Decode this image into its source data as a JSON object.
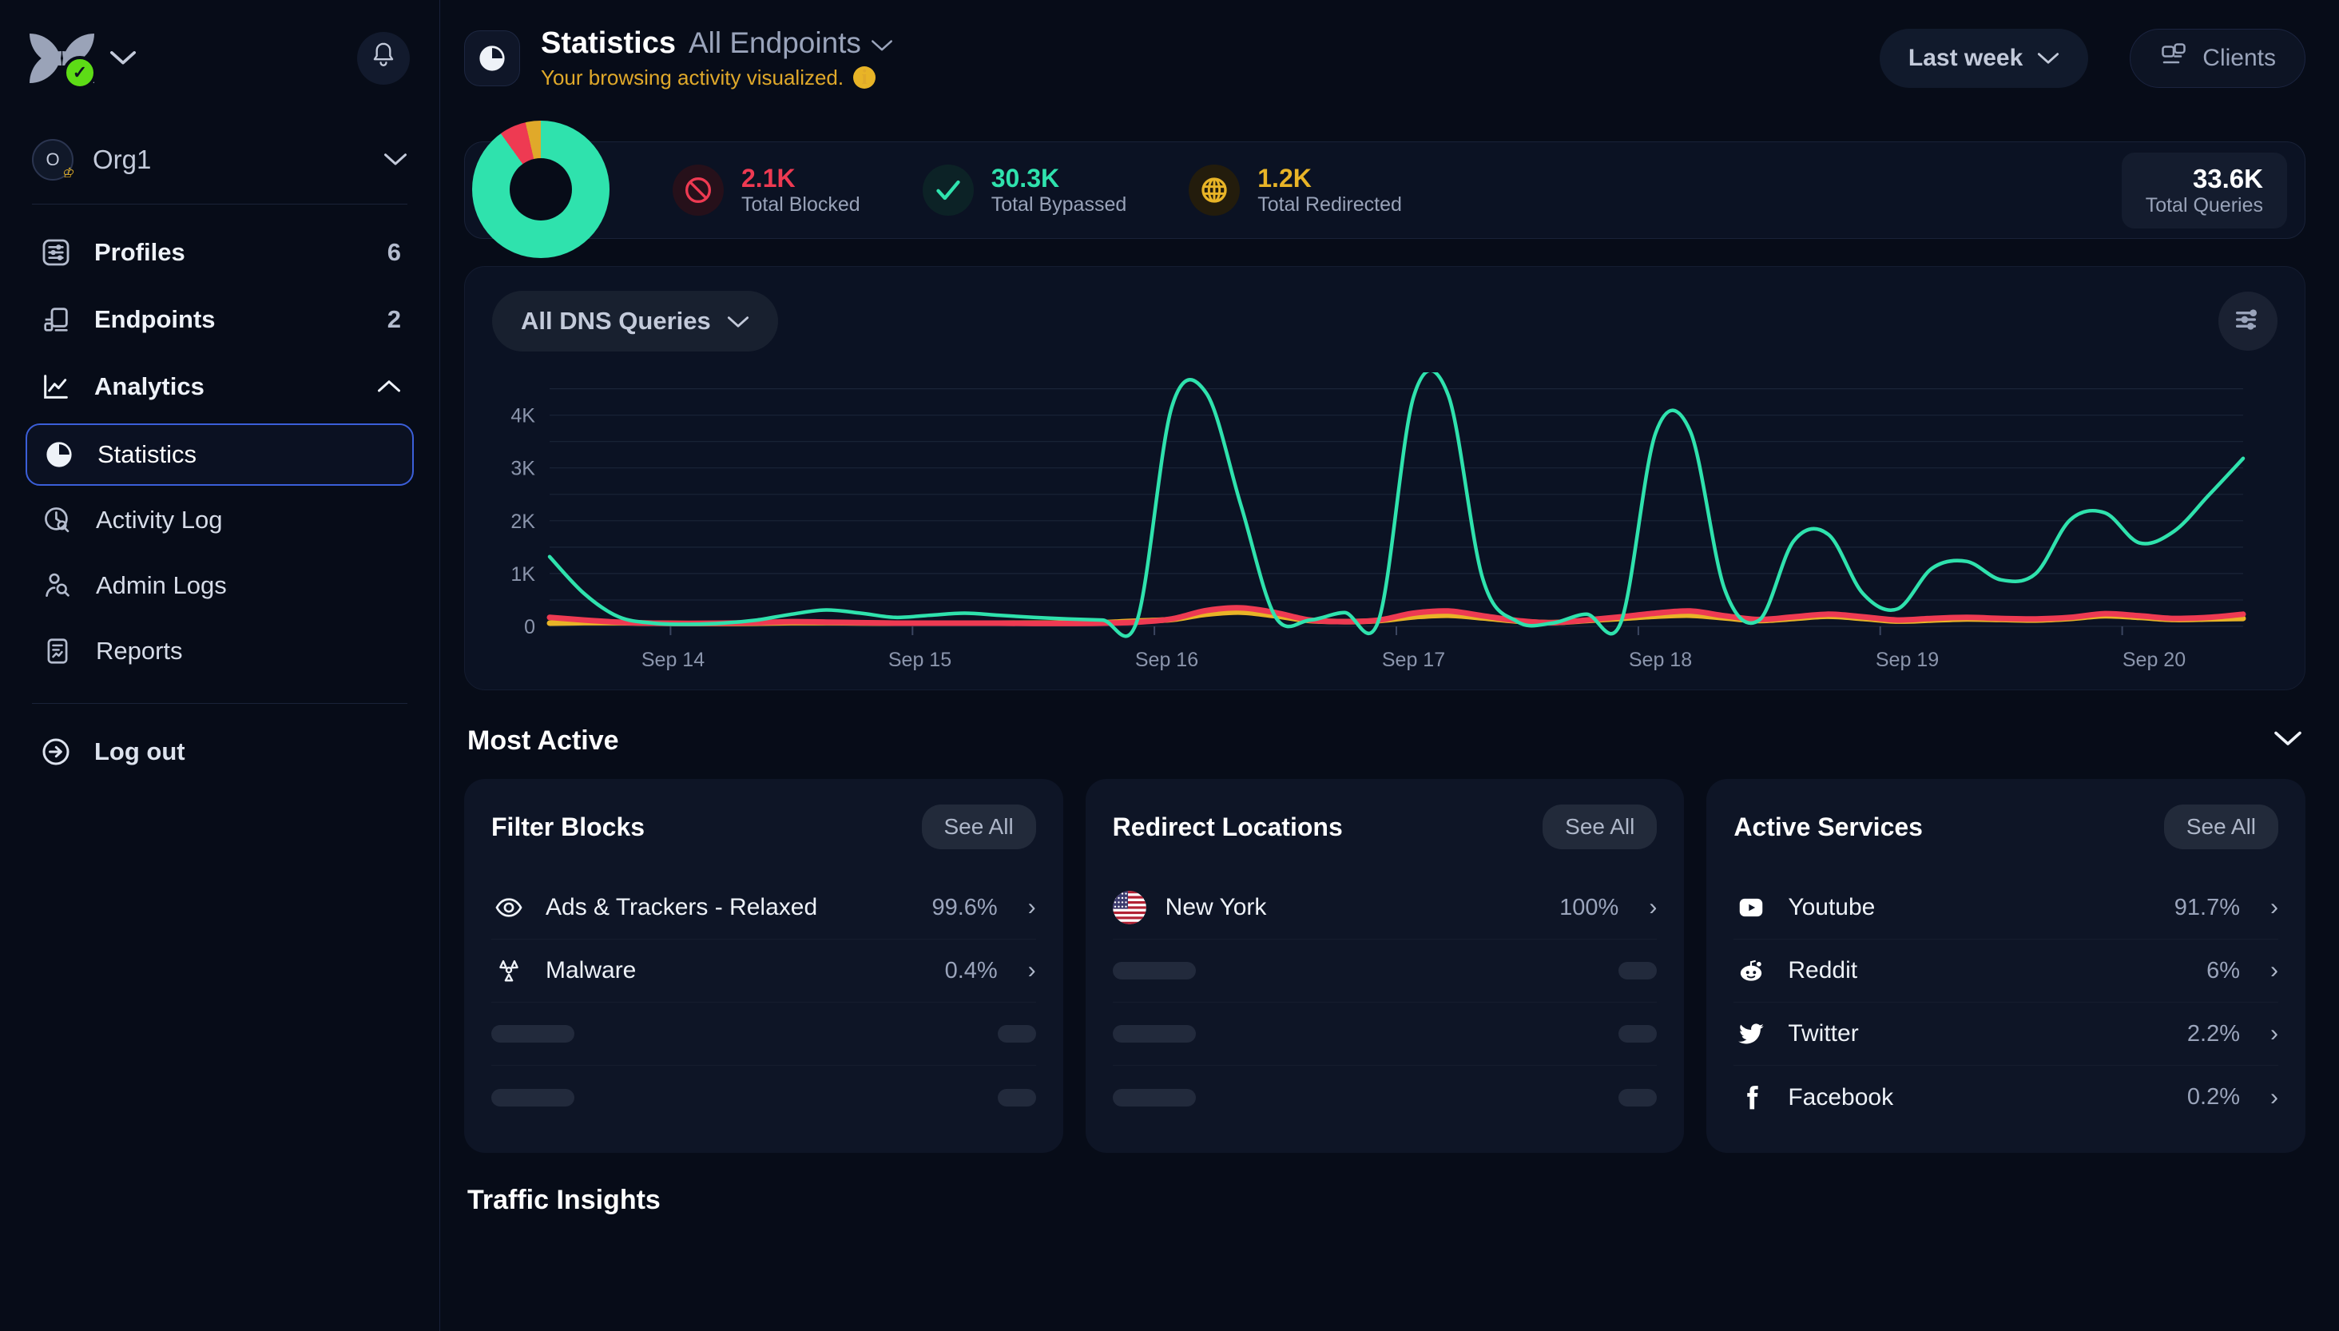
{
  "sidebar": {
    "logo_icon": "nextdns-petals-logo",
    "logo_status": "connected-check",
    "logo_dropdown_icon": "chevron-down-icon",
    "notification_icon": "bell-icon",
    "org": {
      "name": "Org1",
      "avatar_letter": "O",
      "badge_icon": "crown-icon",
      "chevron_icon": "chevron-down-icon"
    },
    "items": [
      {
        "label": "Profiles",
        "count": "6",
        "icon": "sliders-card-icon"
      },
      {
        "label": "Endpoints",
        "count": "2",
        "icon": "devices-icon"
      }
    ],
    "analytics": {
      "label": "Analytics",
      "icon": "line-chart-icon",
      "chevron_icon": "chevron-up-icon"
    },
    "sub_items": [
      {
        "label": "Statistics",
        "icon": "pie-chart-icon",
        "active": true
      },
      {
        "label": "Activity Log",
        "icon": "clock-search-icon",
        "active": false
      },
      {
        "label": "Admin Logs",
        "icon": "user-search-icon",
        "active": false
      },
      {
        "label": "Reports",
        "icon": "report-doc-icon",
        "active": false
      }
    ],
    "logout": {
      "label": "Log out",
      "icon": "logout-arrow-icon"
    }
  },
  "header": {
    "icon": "pie-chart-icon",
    "title": "Statistics",
    "scope": "All Endpoints",
    "scope_chevron_icon": "chevron-down-icon",
    "subtitle": "Your browsing activity visualized.",
    "info_icon": "info-icon",
    "range": {
      "label": "Last week",
      "chevron_icon": "chevron-down-icon"
    },
    "clients": {
      "label": "Clients",
      "icon": "clients-screen-icon"
    }
  },
  "summary": {
    "donut_icon": "donut-chart",
    "stats": [
      {
        "value": "2.1K",
        "label": "Total Blocked",
        "icon": "block-circle-icon",
        "color": "#ee3a52",
        "bg": "#26101a"
      },
      {
        "value": "30.3K",
        "label": "Total Bypassed",
        "icon": "check-icon",
        "color": "#2fe2ad",
        "bg": "#0c2226"
      },
      {
        "value": "1.2K",
        "label": "Total Redirected",
        "icon": "globe-icon",
        "color": "#e8b427",
        "bg": "#231c0c"
      }
    ],
    "total": {
      "value": "33.6K",
      "label": "Total Queries"
    }
  },
  "chart_panel": {
    "filter": {
      "label": "All DNS Queries",
      "chevron_icon": "chevron-down-icon"
    },
    "settings_icon": "sliders-icon"
  },
  "chart_data": {
    "type": "line",
    "title": "",
    "xlabel": "",
    "ylabel": "",
    "ylim": [
      0,
      4600
    ],
    "yticks": [
      0,
      1000,
      2000,
      3000,
      4000
    ],
    "ytick_labels": [
      "0",
      "1K",
      "2K",
      "3K",
      "4K"
    ],
    "grid": true,
    "legend": "none",
    "categories": [
      "Sep 14",
      "Sep 15",
      "Sep 16",
      "Sep 17",
      "Sep 18",
      "Sep 19",
      "Sep 20"
    ],
    "series": [
      {
        "name": "Bypassed",
        "color": "#2fe2ad",
        "values": [
          1320,
          620,
          180,
          60,
          40,
          60,
          120,
          230,
          310,
          250,
          170,
          210,
          250,
          210,
          170,
          140,
          120,
          110,
          4150,
          4420,
          2300,
          180,
          120,
          260,
          140,
          4350,
          4380,
          900,
          90,
          60,
          230,
          80,
          3660,
          3700,
          700,
          120,
          1620,
          1740,
          620,
          330,
          1100,
          1230,
          880,
          1000,
          2020,
          2150,
          1580,
          1800,
          2480,
          3180
        ]
      },
      {
        "name": "Blocked",
        "color": "#ee3a52",
        "values": [
          170,
          120,
          80,
          60,
          55,
          60,
          70,
          90,
          80,
          70,
          60,
          60,
          60,
          60,
          55,
          55,
          60,
          80,
          140,
          300,
          350,
          260,
          120,
          90,
          120,
          250,
          290,
          200,
          110,
          70,
          120,
          180,
          250,
          290,
          200,
          130,
          180,
          230,
          180,
          120,
          150,
          170,
          150,
          140,
          170,
          240,
          200,
          150,
          170,
          230
        ]
      },
      {
        "name": "Redirected",
        "color": "#e8b427",
        "values": [
          60,
          70,
          70,
          60,
          55,
          55,
          60,
          70,
          70,
          65,
          60,
          60,
          60,
          60,
          60,
          60,
          70,
          100,
          130,
          230,
          270,
          200,
          110,
          90,
          110,
          180,
          210,
          160,
          100,
          70,
          110,
          150,
          190,
          210,
          160,
          110,
          150,
          190,
          150,
          100,
          120,
          140,
          130,
          120,
          150,
          200,
          170,
          130,
          140,
          150
        ]
      }
    ]
  },
  "most_active": {
    "title": "Most Active",
    "chevron_icon": "chevron-down-icon",
    "cards": [
      {
        "title": "Filter Blocks",
        "see_all": "See All",
        "rows": [
          {
            "name": "Ads & Trackers - Relaxed",
            "pct": "99.6%",
            "icon": "eye-icon",
            "arrow_icon": "chevron-right-icon"
          },
          {
            "name": "Malware",
            "pct": "0.4%",
            "icon": "radiation-icon",
            "arrow_icon": "chevron-right-icon"
          }
        ],
        "placeholders": 2
      },
      {
        "title": "Redirect Locations",
        "see_all": "See All",
        "rows": [
          {
            "name": "New York",
            "pct": "100%",
            "icon": "us-flag-icon",
            "arrow_icon": "chevron-right-icon"
          }
        ],
        "placeholders": 3
      },
      {
        "title": "Active Services",
        "see_all": "See All",
        "rows": [
          {
            "name": "Youtube",
            "pct": "91.7%",
            "icon": "youtube-icon",
            "arrow_icon": "chevron-right-icon"
          },
          {
            "name": "Reddit",
            "pct": "6%",
            "icon": "reddit-icon",
            "arrow_icon": "chevron-right-icon"
          },
          {
            "name": "Twitter",
            "pct": "2.2%",
            "icon": "twitter-icon",
            "arrow_icon": "chevron-right-icon"
          },
          {
            "name": "Facebook",
            "pct": "0.2%",
            "icon": "facebook-icon",
            "arrow_icon": "chevron-right-icon"
          }
        ],
        "placeholders": 0
      }
    ]
  },
  "traffic_insights": {
    "title": "Traffic Insights"
  },
  "donut": {
    "segments": [
      {
        "name": "Bypassed",
        "pct": 90.1,
        "color": "#2fe2ad"
      },
      {
        "name": "Blocked",
        "pct": 6.3,
        "color": "#ee3a52"
      },
      {
        "name": "Redirected",
        "pct": 3.6,
        "color": "#e0a92a"
      }
    ]
  }
}
